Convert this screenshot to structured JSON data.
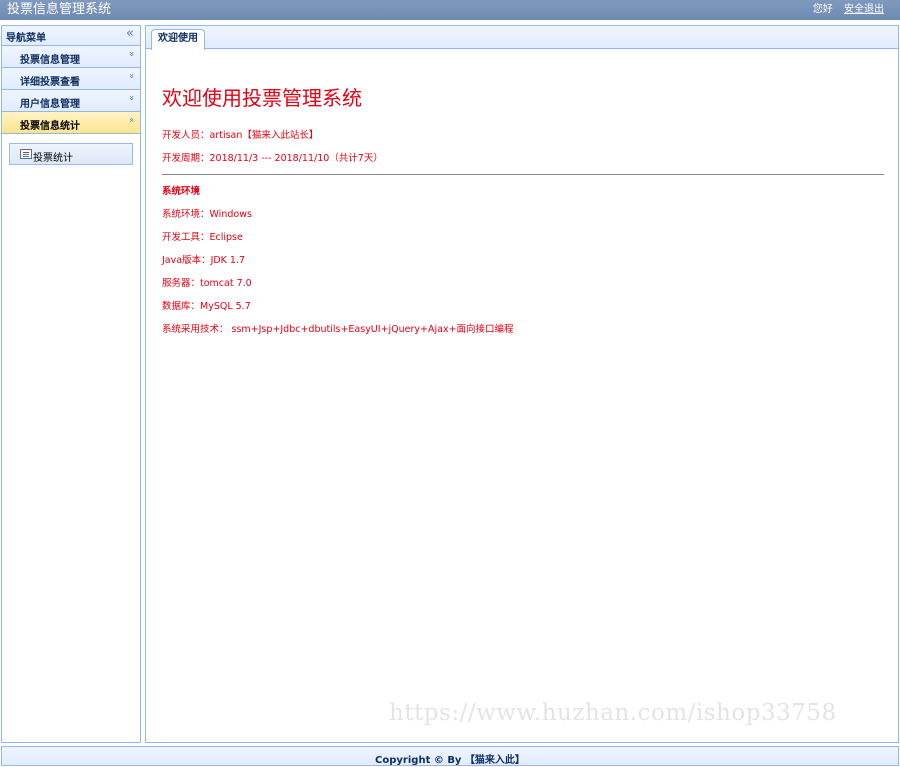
{
  "header": {
    "title": "投票信息管理系统",
    "greeting": "您好",
    "logout": "安全退出"
  },
  "nav": {
    "title": "导航菜单",
    "collapse_icon": "«",
    "items": [
      {
        "label": "投票信息管理",
        "icon": "»"
      },
      {
        "label": "详细投票查看",
        "icon": "»"
      },
      {
        "label": "用户信息管理",
        "icon": "»"
      },
      {
        "label": "投票信息统计",
        "icon": "«"
      }
    ],
    "sub_items": [
      {
        "label": "投票统计"
      }
    ]
  },
  "tabs": [
    {
      "label": "欢迎使用"
    }
  ],
  "content": {
    "heading": "欢迎使用投票管理系统",
    "developer": "开发人员：artisan【猫来入此站长】",
    "period": "开发周期：2018/11/3 --- 2018/11/10（共计7天）",
    "env_title": "系统环境",
    "env_os": "系统环境：Windows",
    "env_tool": "开发工具：Eclipse",
    "env_java": "Java版本：JDK 1.7",
    "env_server": "服务器：tomcat 7.0",
    "env_db": "数据库：MySQL 5.7",
    "env_tech": "系统采用技术： ssm+Jsp+Jdbc+dbutils+EasyUI+jQuery+Ajax+面向接口编程"
  },
  "watermark": "https://www.huzhan.com/ishop33758",
  "footer": {
    "copyright": "Copyright © By 【猫来入此】"
  },
  "colors": {
    "accent_red": "#e60012",
    "header_blue": "#7f99be",
    "border_blue": "#95b8e7",
    "active_yellow": "#ffe48d"
  }
}
